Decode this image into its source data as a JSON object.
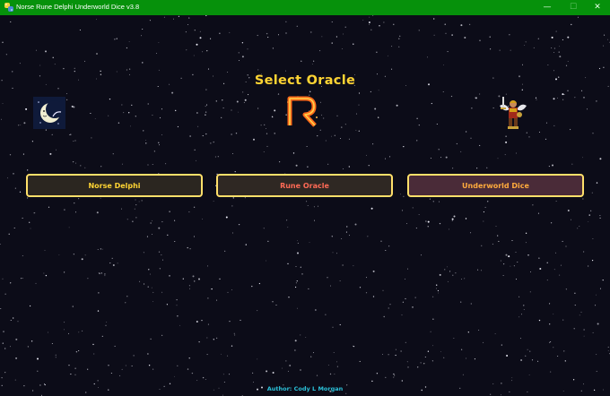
{
  "window": {
    "title": "Norse Rune Delphi Underworld Dice v3.8",
    "controls": {
      "minimize": "—",
      "maximize": "☐",
      "close": "✕"
    }
  },
  "heading": "Select Oracle",
  "oracles": [
    {
      "label": "Norse Delphi",
      "icon": "crescent-moon-icon",
      "text_color": "#ffd433",
      "bg_color": "#2b2620"
    },
    {
      "label": "Rune Oracle",
      "icon": "fiery-rune-r-icon",
      "text_color": "#ff6a55",
      "bg_color": "#2f2823"
    },
    {
      "label": "Underworld Dice",
      "icon": "winged-warrior-icon",
      "text_color": "#ffab3d",
      "bg_color": "#4a2b38"
    }
  ],
  "footer": {
    "author": "Author: Cody L Morgan"
  },
  "colors": {
    "titlebar": "#06910b",
    "background": "#0c0c18",
    "heading": "#ffd433",
    "button_border": "#ffe06a",
    "author": "#2bc0d8"
  }
}
